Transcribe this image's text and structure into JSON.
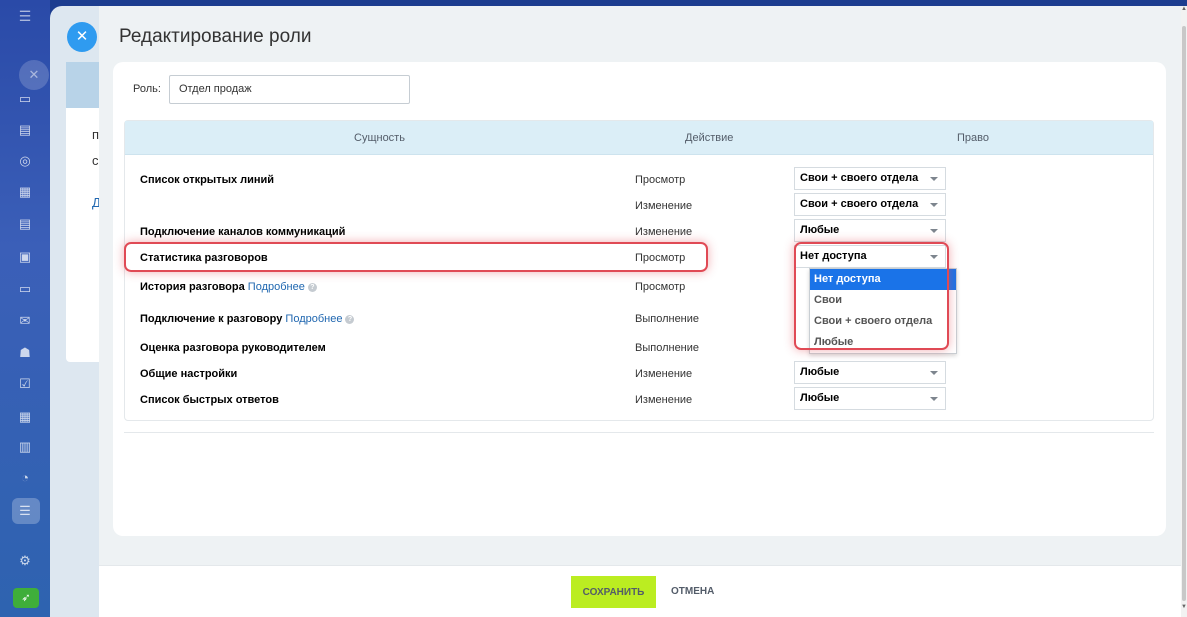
{
  "slider": {
    "title": "Редактирование роли"
  },
  "role": {
    "label": "Роль:",
    "value": "Отдел продаж"
  },
  "table": {
    "headers": {
      "entity": "Сущность",
      "action": "Действие",
      "permission": "Право"
    },
    "rows": [
      {
        "entity": "Список открытых линий",
        "action": "Просмотр",
        "permission": "Свои + своего отдела"
      },
      {
        "entity": "",
        "action": "Изменение",
        "permission": "Свои + своего отдела"
      },
      {
        "entity": "Подключение каналов коммуникаций",
        "action": "Изменение",
        "permission": "Любые"
      },
      {
        "entity": "Статистика разговоров",
        "action": "Просмотр",
        "permission": "Нет доступа"
      },
      {
        "entity": "История разговора",
        "link": "Подробнее",
        "action": "Просмотр",
        "permission": ""
      },
      {
        "entity": "Подключение к разговору",
        "link": "Подробнее",
        "action": "Выполнение",
        "permission": ""
      },
      {
        "entity": "Оценка разговора руководителем",
        "action": "Выполнение",
        "permission": ""
      },
      {
        "entity": "Общие настройки",
        "action": "Изменение",
        "permission": "Любые"
      },
      {
        "entity": "Список быстрых ответов",
        "action": "Изменение",
        "permission": "Любые"
      }
    ]
  },
  "dropdown": {
    "options": [
      "Нет доступа",
      "Свои",
      "Свои + своего отдела",
      "Любые"
    ],
    "selected": "Нет доступа"
  },
  "footer": {
    "save_label": "СОХРАНИТЬ",
    "cancel_label": "ОТМЕНА"
  },
  "background": {
    "partial_letters": [
      "п",
      "с",
      "Д"
    ]
  },
  "colors": {
    "accent": "#2f9bf0",
    "save_button": "#bbed21",
    "highlight": "#e04a55",
    "selected_option": "#1a73e8",
    "table_header": "#dbeef7"
  },
  "icons": {
    "close": "close-icon",
    "caret": "caret-down-icon",
    "help": "help-icon"
  }
}
